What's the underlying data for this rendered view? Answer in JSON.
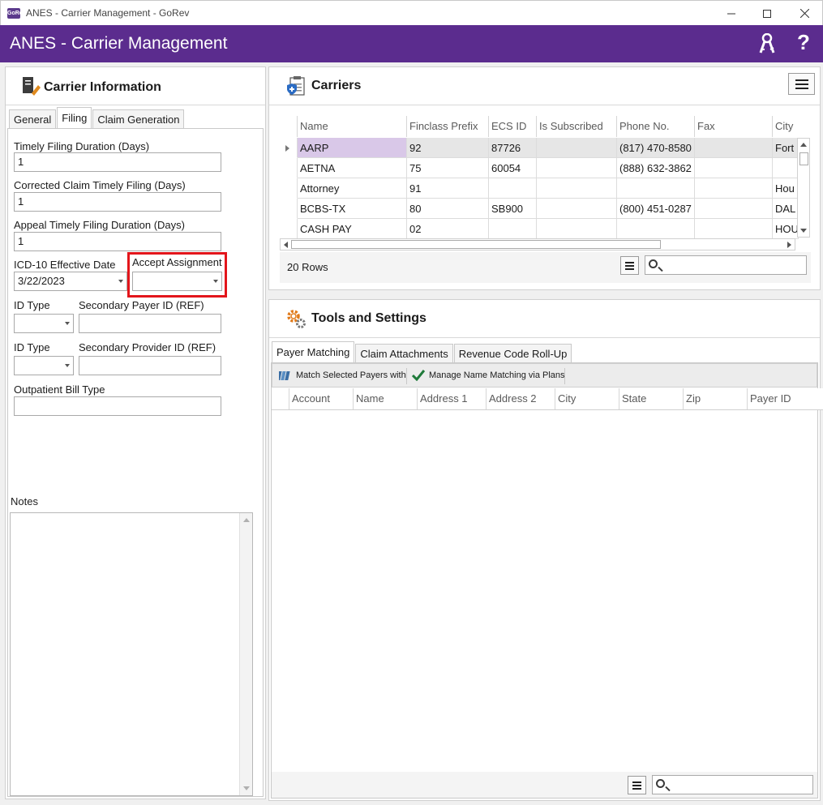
{
  "window": {
    "title": "ANES - Carrier Management - GoRev",
    "app_icon": "GoRev"
  },
  "appbar": {
    "heading": "ANES - Carrier Management",
    "help_glyph": "?"
  },
  "carrier_info": {
    "title": "Carrier Information",
    "tabs": [
      {
        "label": "General"
      },
      {
        "label": "Filing"
      },
      {
        "label": "Claim Generation"
      }
    ],
    "fields": {
      "timely_filing_label": "Timely Filing Duration (Days)",
      "timely_filing_value": "1",
      "corrected_label": "Corrected Claim Timely Filing (Days)",
      "corrected_value": "1",
      "appeal_label": "Appeal Timely Filing Duration (Days)",
      "appeal_value": "1",
      "icd10_label": "ICD-10 Effective Date",
      "icd10_value": "3/22/2023",
      "accept_assignment_label": "Accept Assignment",
      "accept_assignment_value": "",
      "id_type_label_1": "ID Type",
      "secondary_payer_label": "Secondary Payer ID (REF)",
      "id_type_label_2": "ID Type",
      "secondary_provider_label": "Secondary Provider ID (REF)",
      "outpatient_label": "Outpatient Bill Type"
    },
    "notes_label": "Notes"
  },
  "carriers": {
    "title": "Carriers",
    "columns": [
      "Name",
      "Finclass Prefix",
      "ECS ID",
      "Is Subscribed",
      "Phone No.",
      "Fax",
      "City"
    ],
    "rows": [
      {
        "name": "AARP",
        "prefix": "92",
        "ecs": "87726",
        "sub": "",
        "phone": "(817) 470-8580",
        "fax": "",
        "city": "Fort"
      },
      {
        "name": "AETNA",
        "prefix": "75",
        "ecs": "60054",
        "sub": "",
        "phone": "(888) 632-3862",
        "fax": "",
        "city": ""
      },
      {
        "name": "Attorney",
        "prefix": "91",
        "ecs": "",
        "sub": "",
        "phone": "",
        "fax": "",
        "city": "Hou"
      },
      {
        "name": "BCBS-TX",
        "prefix": "80",
        "ecs": "SB900",
        "sub": "",
        "phone": "(800) 451-0287",
        "fax": "",
        "city": "DAL"
      },
      {
        "name": "CASH PAY",
        "prefix": "02",
        "ecs": "",
        "sub": "",
        "phone": "",
        "fax": "",
        "city": "HOU"
      }
    ],
    "row_count": "20 Rows"
  },
  "tools": {
    "title": "Tools and Settings",
    "tabs": [
      {
        "label": "Payer Matching"
      },
      {
        "label": "Claim Attachments"
      },
      {
        "label": "Revenue Code Roll-Up"
      }
    ],
    "toolbar": {
      "match_label": "Match Selected Payers with",
      "manage_label": "Manage Name Matching via Plans"
    },
    "columns": [
      "Account",
      "Name",
      "Address 1",
      "Address 2",
      "City",
      "State",
      "Zip",
      "Payer ID"
    ]
  },
  "colors": {
    "brand": "#5b2c8e",
    "highlight": "#e3151b",
    "selected_cell": "#d9c8e8"
  }
}
